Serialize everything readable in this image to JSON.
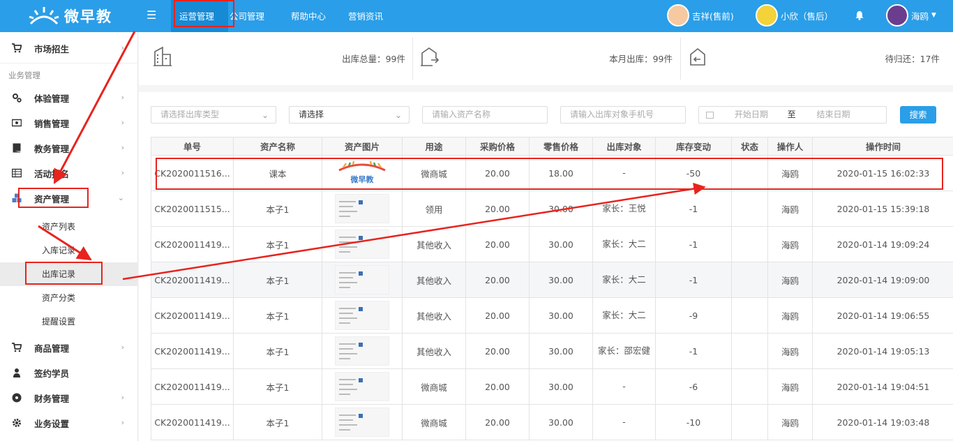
{
  "app": {
    "logo_text": "微早教"
  },
  "topnav": {
    "items": [
      {
        "label": "运营管理"
      },
      {
        "label": "公司管理"
      },
      {
        "label": "帮助中心"
      },
      {
        "label": "营销资讯"
      }
    ]
  },
  "users": {
    "u1": "吉祥(售前)",
    "u2": "小欣（售后）",
    "u3": "海鸥"
  },
  "sidebar": {
    "market": "市场招生",
    "group_label": "业务管理",
    "items": [
      "体验管理",
      "销售管理",
      "教务管理",
      "活动报名",
      "资产管理"
    ],
    "sub": [
      "资产列表",
      "入库记录",
      "出库记录",
      "资产分类",
      "提醒设置"
    ],
    "items2": [
      "商品管理",
      "签约学员",
      "财务管理",
      "业务设置"
    ]
  },
  "stats": {
    "total": "出库总量：99件",
    "month": "本月出库：99件",
    "pending": "待归还：17件"
  },
  "filters": {
    "type_placeholder": "请选择出库类型",
    "select_placeholder": "请选择",
    "asset_placeholder": "请输入资产名称",
    "phone_placeholder": "请输入出库对象手机号",
    "start_date": "开始日期",
    "to": "至",
    "end_date": "结束日期",
    "search": "搜索"
  },
  "table": {
    "headers": [
      "单号",
      "资产名称",
      "资产图片",
      "用途",
      "采购价格",
      "零售价格",
      "出库对象",
      "库存变动",
      "状态",
      "操作人",
      "操作时间"
    ],
    "rows": [
      {
        "no": "CK2020011516...",
        "name": "课本",
        "use": "微商城",
        "buy": "20.00",
        "sell": "18.00",
        "target": "-",
        "change": "-50",
        "status": "",
        "op": "海鸥",
        "time": "2020-01-15 16:02:33"
      },
      {
        "no": "CK2020011515...",
        "name": "本子1",
        "use": "领用",
        "buy": "20.00",
        "sell": "30.00",
        "target": "家长：王悦",
        "change": "-1",
        "status": "",
        "op": "海鸥",
        "time": "2020-01-15 15:39:18"
      },
      {
        "no": "CK2020011419...",
        "name": "本子1",
        "use": "其他收入",
        "buy": "20.00",
        "sell": "30.00",
        "target": "家长：大二",
        "change": "-1",
        "status": "",
        "op": "海鸥",
        "time": "2020-01-14 19:09:24"
      },
      {
        "no": "CK2020011419...",
        "name": "本子1",
        "use": "其他收入",
        "buy": "20.00",
        "sell": "30.00",
        "target": "家长：大二",
        "change": "-1",
        "status": "",
        "op": "海鸥",
        "time": "2020-01-14 19:09:00"
      },
      {
        "no": "CK2020011419...",
        "name": "本子1",
        "use": "其他收入",
        "buy": "20.00",
        "sell": "30.00",
        "target": "家长：大二",
        "change": "-9",
        "status": "",
        "op": "海鸥",
        "time": "2020-01-14 19:06:55"
      },
      {
        "no": "CK2020011419...",
        "name": "本子1",
        "use": "其他收入",
        "buy": "20.00",
        "sell": "30.00",
        "target": "家长：邵宏健",
        "change": "-1",
        "status": "",
        "op": "海鸥",
        "time": "2020-01-14 19:05:13"
      },
      {
        "no": "CK2020011419...",
        "name": "本子1",
        "use": "微商城",
        "buy": "20.00",
        "sell": "30.00",
        "target": "-",
        "change": "-6",
        "status": "",
        "op": "海鸥",
        "time": "2020-01-14 19:04:51"
      },
      {
        "no": "CK2020011419...",
        "name": "本子1",
        "use": "微商城",
        "buy": "20.00",
        "sell": "30.00",
        "target": "-",
        "change": "-10",
        "status": "",
        "op": "海鸥",
        "time": "2020-01-14 19:03:48"
      }
    ]
  },
  "colors": {
    "accent": "#2a9ee8",
    "annotation": "#e8231d"
  }
}
